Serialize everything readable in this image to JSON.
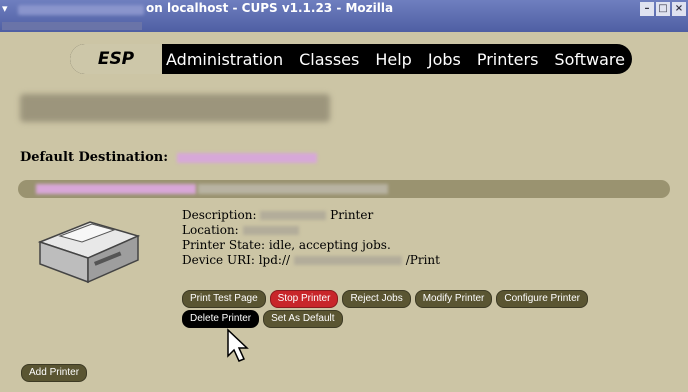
{
  "window": {
    "title": "on localhost - CUPS v1.1.23 - Mozilla",
    "buttons": [
      "–",
      "□",
      "×"
    ]
  },
  "nav": {
    "items": [
      "ESP",
      "Administration",
      "Classes",
      "Help",
      "Jobs",
      "Printers",
      "Software"
    ]
  },
  "default_destination_label": "Default Destination:",
  "printer": {
    "description_label": "Description:",
    "description_value": "Printer",
    "location_label": "Location:",
    "state": "Printer State: idle, accepting jobs.",
    "uri_label": "Device URI: lpd://",
    "uri_suffix": "/Print"
  },
  "buttons": {
    "print_test_page": "Print Test Page",
    "stop_printer": "Stop Printer",
    "reject_jobs": "Reject Jobs",
    "modify_printer": "Modify Printer",
    "configure_printer": "Configure Printer",
    "delete_printer": "Delete Printer",
    "set_as_default": "Set As Default",
    "add_printer": "Add Printer"
  }
}
